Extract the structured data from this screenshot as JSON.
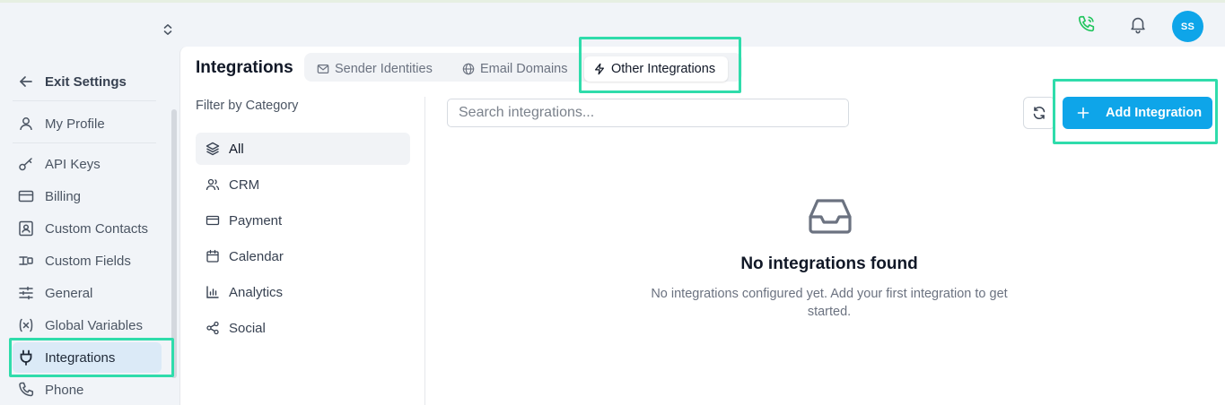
{
  "header": {
    "avatar_initials": "SS",
    "phone_icon": "phone-icon",
    "bell_icon": "bell-icon",
    "phone_color": "#22c55e",
    "avatar_color": "#0ea5e9"
  },
  "sidebar": {
    "exit_label": "Exit Settings",
    "items": [
      {
        "label": "My Profile",
        "icon": "user-icon"
      },
      {
        "label": "API Keys",
        "icon": "key-icon"
      },
      {
        "label": "Billing",
        "icon": "credit-card-icon"
      },
      {
        "label": "Custom Contacts",
        "icon": "contact-card-icon"
      },
      {
        "label": "Custom Fields",
        "icon": "fields-icon"
      },
      {
        "label": "General",
        "icon": "sliders-icon"
      },
      {
        "label": "Global Variables",
        "icon": "variable-icon"
      },
      {
        "label": "Integrations",
        "icon": "plug-icon",
        "active": true
      },
      {
        "label": "Phone",
        "icon": "phone-icon"
      }
    ]
  },
  "main": {
    "title": "Integrations",
    "tabs": [
      {
        "label": "Sender Identities",
        "icon": "mail-icon"
      },
      {
        "label": "Email Domains",
        "icon": "globe-icon"
      },
      {
        "label": "Other Integrations",
        "icon": "zap-icon",
        "active": true
      }
    ],
    "filter_label": "Filter by Category",
    "categories": [
      {
        "label": "All",
        "icon": "layers-icon",
        "active": true
      },
      {
        "label": "CRM",
        "icon": "users-icon"
      },
      {
        "label": "Payment",
        "icon": "credit-card-icon"
      },
      {
        "label": "Calendar",
        "icon": "calendar-icon"
      },
      {
        "label": "Analytics",
        "icon": "bar-chart-icon"
      },
      {
        "label": "Social",
        "icon": "share-icon"
      }
    ],
    "search_placeholder": "Search integrations...",
    "add_button_label": "Add Integration",
    "empty_title": "No integrations found",
    "empty_text": "No integrations configured yet. Add your first integration to get started."
  },
  "colors": {
    "accent": "#0ea5e9",
    "highlight": "#2fdcab",
    "active_sidebar_bg": "#dbeaf7"
  }
}
